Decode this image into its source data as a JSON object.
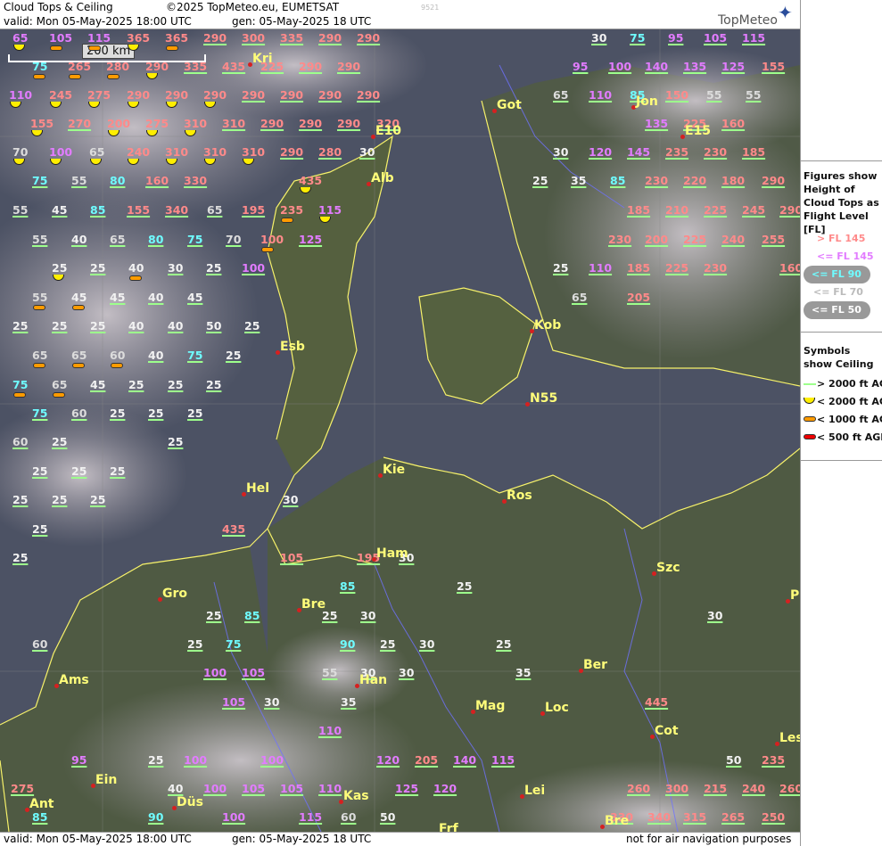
{
  "header": {
    "title": "Cloud Tops & Ceiling",
    "copyright": "©2025 TopMeteo.eu, EUMETSAT",
    "code": "9521",
    "valid": "valid:  Mon  05-May-2025  18:00 UTC",
    "gen": "gen: 05-May-2025 18 UTC",
    "logo": "TopMeteo"
  },
  "scale_label": "200 km",
  "footer": {
    "valid": "valid:  Mon  05-May-2025  18:00 UTC",
    "gen": "gen: 05-May-2025 18 UTC",
    "disclaimer": "not for air navigation purposes"
  },
  "legend": {
    "figures_title": "Figures show Height of Cloud Tops as Flight Level [FL]",
    "figures": [
      {
        "label": "> FL 145",
        "color": "#ff8a8a"
      },
      {
        "label": "<= FL 145",
        "color": "#e27cff"
      },
      {
        "label": "<= FL 90",
        "color": "#6ffcff"
      },
      {
        "label": "<= FL 70",
        "color": "#bbbbbb"
      },
      {
        "label": "<= FL 50",
        "color": "#ffffff"
      }
    ],
    "symbols_title": "Symbols show Ceiling",
    "symbols": [
      {
        "label": "> 2000 ft AGL",
        "icon": "green-line"
      },
      {
        "label": "< 2000 ft AGL",
        "icon": "yellow-half-circle"
      },
      {
        "label": "< 1000 ft AGL",
        "icon": "orange-pill"
      },
      {
        "label": "< 500 ft AGL",
        "icon": "red-pill"
      }
    ]
  },
  "cities": [
    "Kri",
    "Got",
    "Jon",
    "Alb",
    "E10",
    "E15",
    "Kob",
    "Esb",
    "N55",
    "Hel",
    "Kie",
    "Ros",
    "Ham",
    "Szc",
    "Gro",
    "Bre",
    "Ams",
    "Han",
    "Ber",
    "Mag",
    "Loc",
    "Cot",
    "Les",
    "Ein",
    "Kas",
    "Lei",
    "Ant",
    "Düs",
    "Frf",
    "Bre",
    "P"
  ],
  "figures": [
    [
      "65",
      "v",
      "y"
    ],
    [
      "105",
      "v",
      "o"
    ],
    [
      "115",
      "v",
      "o"
    ],
    [
      "365",
      "r",
      "y"
    ],
    [
      "365",
      "r",
      "o"
    ],
    [
      "290",
      "r",
      ""
    ],
    [
      "300",
      "r",
      ""
    ],
    [
      "335",
      "r",
      ""
    ],
    [
      "290",
      "r",
      ""
    ],
    [
      "290",
      "r",
      ""
    ],
    [
      "30",
      "w",
      ""
    ],
    [
      "75",
      "c",
      ""
    ],
    [
      "95",
      "v",
      ""
    ],
    [
      "105",
      "v",
      ""
    ],
    [
      "115",
      "v",
      ""
    ],
    [
      "75",
      "c",
      "o"
    ],
    [
      "265",
      "r",
      "o"
    ],
    [
      "280",
      "r",
      "o"
    ],
    [
      "290",
      "r",
      "y"
    ],
    [
      "335",
      "r",
      ""
    ],
    [
      "435",
      "r",
      ""
    ],
    [
      "225",
      "r",
      ""
    ],
    [
      "290",
      "r",
      ""
    ],
    [
      "290",
      "r",
      ""
    ],
    [
      "95",
      "v",
      ""
    ],
    [
      "100",
      "v",
      ""
    ],
    [
      "140",
      "v",
      ""
    ],
    [
      "135",
      "v",
      ""
    ],
    [
      "125",
      "v",
      ""
    ],
    [
      "155",
      "r",
      ""
    ],
    [
      "110",
      "v",
      "y"
    ],
    [
      "245",
      "r",
      "y"
    ],
    [
      "275",
      "r",
      "y"
    ],
    [
      "290",
      "r",
      "y"
    ],
    [
      "290",
      "r",
      "y"
    ],
    [
      "290",
      "r",
      "y"
    ],
    [
      "290",
      "r",
      ""
    ],
    [
      "290",
      "r",
      ""
    ],
    [
      "290",
      "r",
      ""
    ],
    [
      "290",
      "r",
      ""
    ],
    [
      "65",
      "g",
      ""
    ],
    [
      "110",
      "v",
      ""
    ],
    [
      "85",
      "c",
      ""
    ],
    [
      "150",
      "r",
      ""
    ],
    [
      "55",
      "g",
      ""
    ],
    [
      "55",
      "g",
      ""
    ],
    [
      "155",
      "r",
      "y"
    ],
    [
      "270",
      "r",
      ""
    ],
    [
      "200",
      "r",
      "y"
    ],
    [
      "275",
      "r",
      "y"
    ],
    [
      "310",
      "r",
      "y"
    ],
    [
      "310",
      "r",
      ""
    ],
    [
      "290",
      "r",
      ""
    ],
    [
      "290",
      "r",
      ""
    ],
    [
      "290",
      "r",
      ""
    ],
    [
      "320",
      "r",
      ""
    ],
    [
      "135",
      "v",
      ""
    ],
    [
      "225",
      "r",
      ""
    ],
    [
      "160",
      "r",
      ""
    ],
    [
      "70",
      "g",
      "y"
    ],
    [
      "100",
      "v",
      "y"
    ],
    [
      "65",
      "g",
      "y"
    ],
    [
      "240",
      "r",
      "y"
    ],
    [
      "310",
      "r",
      "y"
    ],
    [
      "310",
      "r",
      "y"
    ],
    [
      "310",
      "r",
      "y"
    ],
    [
      "290",
      "r",
      ""
    ],
    [
      "280",
      "r",
      ""
    ],
    [
      "30",
      "w",
      ""
    ],
    [
      "30",
      "w",
      ""
    ],
    [
      "120",
      "v",
      ""
    ],
    [
      "145",
      "v",
      ""
    ],
    [
      "235",
      "r",
      ""
    ],
    [
      "230",
      "r",
      ""
    ],
    [
      "185",
      "r",
      ""
    ],
    [
      "75",
      "c",
      ""
    ],
    [
      "55",
      "g",
      ""
    ],
    [
      "80",
      "c",
      ""
    ],
    [
      "160",
      "r",
      ""
    ],
    [
      "330",
      "r",
      ""
    ],
    [
      "435",
      "r",
      "y"
    ],
    [
      "25",
      "w",
      ""
    ],
    [
      "35",
      "w",
      ""
    ],
    [
      "85",
      "c",
      ""
    ],
    [
      "230",
      "r",
      ""
    ],
    [
      "220",
      "r",
      ""
    ],
    [
      "180",
      "r",
      ""
    ],
    [
      "290",
      "r",
      ""
    ],
    [
      "55",
      "g",
      ""
    ],
    [
      "45",
      "w",
      ""
    ],
    [
      "85",
      "c",
      ""
    ],
    [
      "155",
      "r",
      ""
    ],
    [
      "340",
      "r",
      ""
    ],
    [
      "65",
      "g",
      ""
    ],
    [
      "195",
      "r",
      ""
    ],
    [
      "235",
      "r",
      "o"
    ],
    [
      "115",
      "v",
      "y"
    ],
    [
      "185",
      "r",
      ""
    ],
    [
      "210",
      "r",
      ""
    ],
    [
      "225",
      "r",
      ""
    ],
    [
      "245",
      "r",
      ""
    ],
    [
      "290",
      "r",
      ""
    ],
    [
      "55",
      "g",
      ""
    ],
    [
      "40",
      "w",
      ""
    ],
    [
      "65",
      "g",
      ""
    ],
    [
      "80",
      "c",
      ""
    ],
    [
      "75",
      "c",
      ""
    ],
    [
      "70",
      "g",
      ""
    ],
    [
      "100",
      "r",
      "o"
    ],
    [
      "125",
      "v",
      ""
    ],
    [
      "230",
      "r",
      ""
    ],
    [
      "200",
      "r",
      ""
    ],
    [
      "225",
      "r",
      ""
    ],
    [
      "240",
      "r",
      ""
    ],
    [
      "255",
      "r",
      ""
    ],
    [
      "25",
      "w",
      "y"
    ],
    [
      "25",
      "w",
      ""
    ],
    [
      "40",
      "w",
      "o"
    ],
    [
      "30",
      "w",
      ""
    ],
    [
      "25",
      "w",
      ""
    ],
    [
      "100",
      "v",
      ""
    ],
    [
      "25",
      "w",
      ""
    ],
    [
      "110",
      "v",
      ""
    ],
    [
      "185",
      "r",
      ""
    ],
    [
      "225",
      "r",
      ""
    ],
    [
      "230",
      "r",
      ""
    ],
    [
      "160",
      "r",
      ""
    ],
    [
      "55",
      "g",
      "o"
    ],
    [
      "45",
      "w",
      "o"
    ],
    [
      "45",
      "w",
      ""
    ],
    [
      "40",
      "w",
      ""
    ],
    [
      "45",
      "w",
      ""
    ],
    [
      "65",
      "g",
      ""
    ],
    [
      "205",
      "r",
      ""
    ],
    [
      "25",
      "w",
      ""
    ],
    [
      "25",
      "w",
      ""
    ],
    [
      "25",
      "w",
      ""
    ],
    [
      "40",
      "w",
      ""
    ],
    [
      "40",
      "w",
      ""
    ],
    [
      "50",
      "w",
      ""
    ],
    [
      "25",
      "w",
      ""
    ],
    [
      "65",
      "g",
      "o"
    ],
    [
      "65",
      "g",
      "o"
    ],
    [
      "60",
      "g",
      "o"
    ],
    [
      "40",
      "w",
      ""
    ],
    [
      "75",
      "c",
      ""
    ],
    [
      "25",
      "w",
      ""
    ],
    [
      "75",
      "c",
      "o"
    ],
    [
      "65",
      "g",
      "o"
    ],
    [
      "45",
      "w",
      ""
    ],
    [
      "25",
      "w",
      ""
    ],
    [
      "25",
      "w",
      ""
    ],
    [
      "25",
      "w",
      ""
    ],
    [
      "75",
      "c",
      ""
    ],
    [
      "60",
      "g",
      ""
    ],
    [
      "25",
      "w",
      ""
    ],
    [
      "25",
      "w",
      ""
    ],
    [
      "25",
      "w",
      ""
    ],
    [
      "60",
      "g",
      ""
    ],
    [
      "25",
      "w",
      ""
    ],
    [
      "25",
      "w",
      ""
    ],
    [
      "25",
      "w",
      ""
    ],
    [
      "25",
      "w",
      ""
    ],
    [
      "25",
      "w",
      ""
    ],
    [
      "25",
      "w",
      ""
    ],
    [
      "25",
      "w",
      ""
    ],
    [
      "25",
      "w",
      ""
    ],
    [
      "30",
      "w",
      ""
    ],
    [
      "25",
      "w",
      ""
    ],
    [
      "435",
      "r",
      ""
    ],
    [
      "25",
      "w",
      ""
    ],
    [
      "105",
      "r",
      ""
    ],
    [
      "195",
      "r",
      ""
    ],
    [
      "30",
      "w",
      ""
    ],
    [
      "85",
      "c",
      ""
    ],
    [
      "25",
      "w",
      ""
    ],
    [
      "25",
      "w",
      ""
    ],
    [
      "85",
      "c",
      ""
    ],
    [
      "25",
      "w",
      ""
    ],
    [
      "30",
      "w",
      ""
    ],
    [
      "30",
      "w",
      ""
    ],
    [
      "60",
      "g",
      ""
    ],
    [
      "25",
      "w",
      ""
    ],
    [
      "75",
      "c",
      ""
    ],
    [
      "90",
      "c",
      ""
    ],
    [
      "25",
      "w",
      ""
    ],
    [
      "30",
      "w",
      ""
    ],
    [
      "25",
      "w",
      ""
    ],
    [
      "100",
      "v",
      ""
    ],
    [
      "105",
      "v",
      ""
    ],
    [
      "55",
      "g",
      ""
    ],
    [
      "30",
      "w",
      ""
    ],
    [
      "30",
      "w",
      ""
    ],
    [
      "35",
      "w",
      ""
    ],
    [
      "105",
      "v",
      ""
    ],
    [
      "30",
      "w",
      ""
    ],
    [
      "35",
      "w",
      ""
    ],
    [
      "445",
      "r",
      ""
    ],
    [
      "110",
      "v",
      ""
    ],
    [
      "95",
      "v",
      ""
    ],
    [
      "25",
      "w",
      ""
    ],
    [
      "100",
      "v",
      ""
    ],
    [
      "100",
      "v",
      ""
    ],
    [
      "120",
      "v",
      ""
    ],
    [
      "205",
      "r",
      ""
    ],
    [
      "140",
      "v",
      ""
    ],
    [
      "115",
      "v",
      ""
    ],
    [
      "50",
      "w",
      ""
    ],
    [
      "235",
      "r",
      ""
    ],
    [
      "275",
      "r",
      ""
    ],
    [
      "40",
      "w",
      ""
    ],
    [
      "100",
      "v",
      ""
    ],
    [
      "105",
      "v",
      ""
    ],
    [
      "105",
      "v",
      ""
    ],
    [
      "110",
      "v",
      ""
    ],
    [
      "125",
      "v",
      ""
    ],
    [
      "120",
      "v",
      ""
    ],
    [
      "260",
      "r",
      ""
    ],
    [
      "300",
      "r",
      ""
    ],
    [
      "215",
      "r",
      ""
    ],
    [
      "240",
      "r",
      ""
    ],
    [
      "260",
      "r",
      ""
    ],
    [
      "85",
      "c",
      ""
    ],
    [
      "90",
      "c",
      ""
    ],
    [
      "100",
      "v",
      ""
    ],
    [
      "115",
      "v",
      ""
    ],
    [
      "60",
      "g",
      ""
    ],
    [
      "50",
      "w",
      ""
    ],
    [
      "330",
      "r",
      ""
    ],
    [
      "340",
      "r",
      ""
    ],
    [
      "315",
      "r",
      ""
    ],
    [
      "265",
      "r",
      ""
    ],
    [
      "250",
      "r",
      ""
    ]
  ]
}
